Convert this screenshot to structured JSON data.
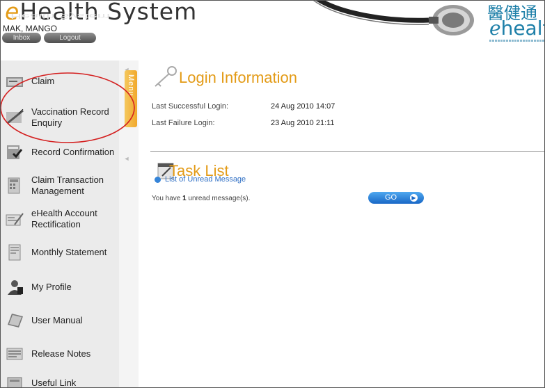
{
  "header": {
    "title_e": "e",
    "title_rest": "Health System",
    "user_name": "MAK, MANGO",
    "inbox_label": "Inbox",
    "logout_label": "Logout",
    "logo_cn": "醫健通",
    "logo_en_e": "e",
    "logo_en_rest": "health"
  },
  "sidebar": {
    "menu_tab_label": "Menu",
    "items": [
      {
        "label": "Claim",
        "icon": "claim-icon"
      },
      {
        "label": "Vaccination Record Enquiry",
        "icon": "syringe-icon"
      },
      {
        "label": "Record Confirmation",
        "icon": "record-confirmation-icon"
      },
      {
        "label": "Claim Transaction Management",
        "icon": "calculator-icon"
      },
      {
        "label": "eHealth Account Rectification",
        "icon": "account-rectification-icon"
      },
      {
        "label": "Monthly Statement",
        "icon": "statement-icon"
      },
      {
        "label": "My Profile",
        "icon": "profile-icon"
      },
      {
        "label": "User Manual",
        "icon": "manual-icon"
      },
      {
        "label": "Release Notes",
        "icon": "notes-icon"
      },
      {
        "label": "Useful Link",
        "icon": "link-icon"
      }
    ]
  },
  "login_info": {
    "title": "Login Information",
    "last_success_label": "Last Successful Login:",
    "last_success_value": "24 Aug 2010 14:07",
    "last_failure_label": "Last Failure Login:",
    "last_failure_value": "23 Aug 2010 21:11"
  },
  "task_list": {
    "title": "Task List",
    "link_label": "List of Unread Message",
    "msg_prefix": "You have ",
    "unread_count": "1",
    "msg_suffix": " unread message(s).",
    "go_label": "GO"
  },
  "colors": {
    "accent_orange": "#e39b17",
    "link_blue": "#2f6fc4",
    "button_blue": "#1867c6",
    "annotation_red": "#d42020",
    "logo_teal": "#1d7fa8"
  }
}
